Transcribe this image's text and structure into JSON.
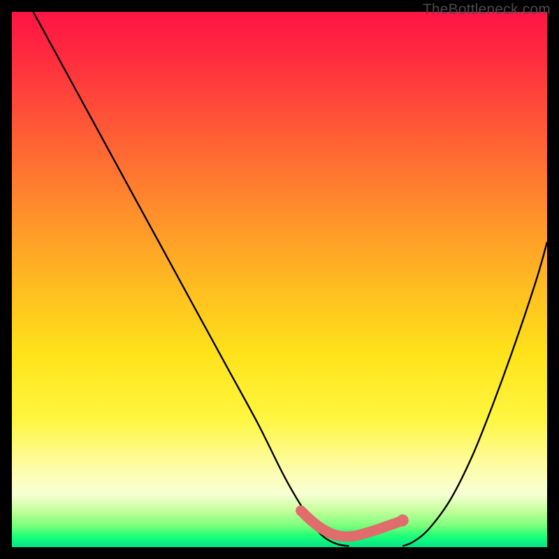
{
  "watermark": "TheBottleneck.com",
  "chart_data": {
    "type": "line",
    "title": "",
    "xlabel": "",
    "ylabel": "",
    "xlim": [
      0,
      100
    ],
    "ylim": [
      0,
      100
    ],
    "series": [
      {
        "name": "left-curve",
        "x": [
          4,
          10,
          16,
          22,
          28,
          34,
          40,
          46,
          51,
          54.5,
          57,
          59,
          61,
          63
        ],
        "y": [
          100,
          89,
          78,
          67,
          56,
          45,
          34,
          23,
          13,
          7,
          3.2,
          1.4,
          0.5,
          0.2
        ]
      },
      {
        "name": "right-curve",
        "x": [
          73,
          75,
          78,
          82,
          86,
          90,
          94,
          98,
          100
        ],
        "y": [
          0.2,
          1.0,
          3.5,
          9,
          17,
          27,
          38,
          50,
          57
        ]
      },
      {
        "name": "bottom-band",
        "x": [
          54,
          56,
          58,
          60,
          62,
          64,
          66,
          68,
          70,
          72,
          73
        ],
        "y": [
          6.8,
          4.9,
          3.4,
          2.4,
          2.0,
          2.1,
          2.6,
          3.2,
          3.9,
          4.6,
          5.0
        ]
      }
    ],
    "marker": {
      "x": 73,
      "y": 5.0
    },
    "colors": {
      "curve": "#000000",
      "band": "#e06c6c",
      "marker": "#e06c6c",
      "gradient_top": "#ff1446",
      "gradient_bottom": "#00e68a"
    }
  }
}
